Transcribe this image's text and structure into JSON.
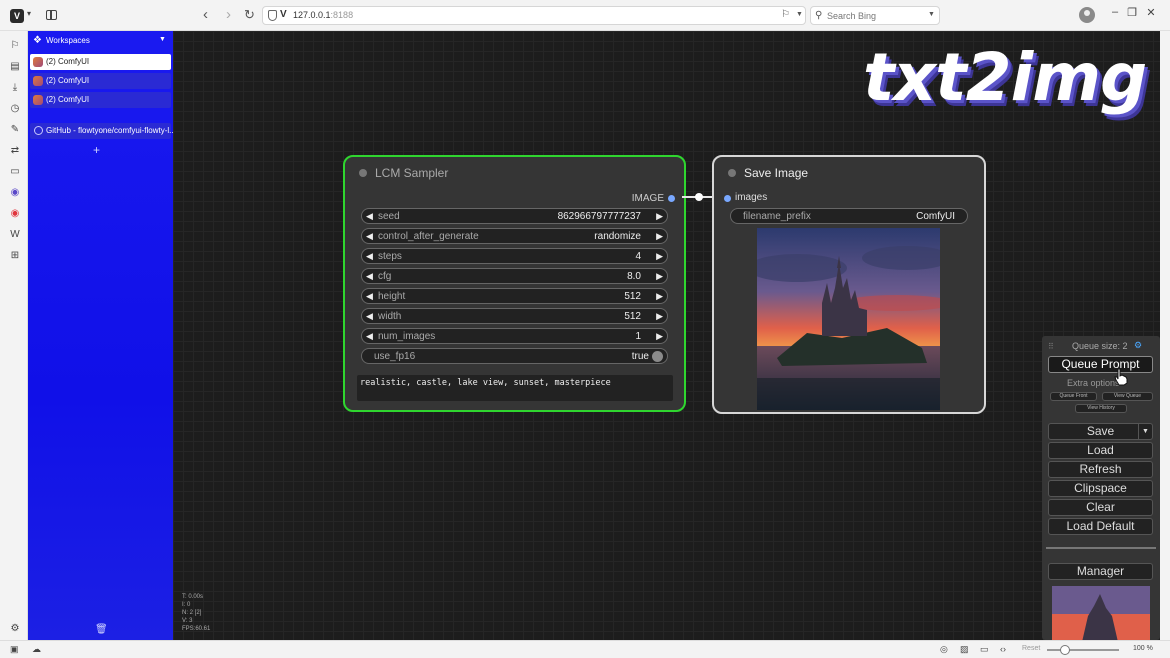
{
  "browser": {
    "logo": "V",
    "url_host": "127.0.0.1",
    "url_port": ":8188",
    "search_placeholder": "Search Bing"
  },
  "workspaces": {
    "title": "Workspaces",
    "tabs": [
      {
        "label": "(2) ComfyUI",
        "state": "active"
      },
      {
        "label": "(2) ComfyUI",
        "state": "highlight"
      },
      {
        "label": "(2) ComfyUI",
        "state": "highlight"
      },
      {
        "label": "GitHub - flowtyone/comfyui-flowty-l...",
        "state": "highlight"
      }
    ]
  },
  "title_art": "txt2img",
  "lcm_node": {
    "title": "LCM Sampler",
    "output": "IMAGE",
    "widgets": [
      {
        "name": "seed",
        "value": "862966797777237"
      },
      {
        "name": "control_after_generate",
        "value": "randomize"
      },
      {
        "name": "steps",
        "value": "4"
      },
      {
        "name": "cfg",
        "value": "8.0"
      },
      {
        "name": "height",
        "value": "512"
      },
      {
        "name": "width",
        "value": "512"
      },
      {
        "name": "num_images",
        "value": "1"
      }
    ],
    "toggle": {
      "name": "use_fp16",
      "value": "true"
    },
    "prompt": "realistic, castle, lake view, sunset, masterpiece"
  },
  "save_node": {
    "title": "Save Image",
    "input": "images",
    "filename_label": "filename_prefix",
    "filename_value": "ComfyUI"
  },
  "stats": [
    "T: 0.00s",
    "I: 0",
    "N: 2 [2]",
    "V: 3",
    "FPS:60.61"
  ],
  "menu": {
    "queue_size": "Queue size: 2",
    "queue_prompt": "Queue Prompt",
    "extra_options": "Extra options",
    "queue_front": "Queue Front",
    "view_queue": "View Queue",
    "view_history": "View History",
    "save": "Save",
    "load": "Load",
    "refresh": "Refresh",
    "clipspace": "Clipspace",
    "clear": "Clear",
    "load_default": "Load Default",
    "manager": "Manager"
  },
  "statusbar": {
    "reset": "Reset",
    "zoom": "100 %"
  },
  "colors": {
    "sidebar": "#1414ee",
    "lcm_border": "#2fd62f",
    "canvas": "#1d1d1d",
    "title_shadow": "#5b54c9"
  }
}
